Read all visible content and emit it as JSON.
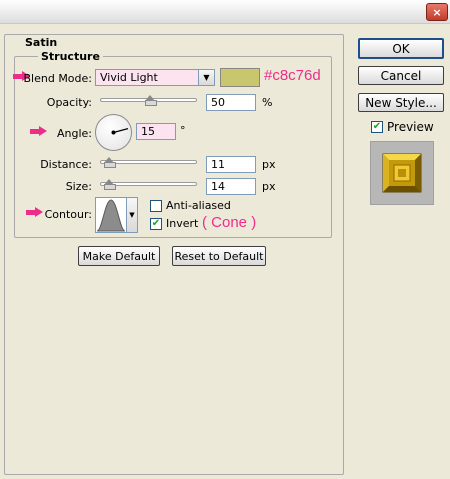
{
  "window": {
    "close_label": "×"
  },
  "panel": {
    "title": "Satin",
    "group_title": "Structure"
  },
  "blend_mode": {
    "label": "Blend Mode:",
    "value": "Vivid Light",
    "color": "#c8c76d",
    "color_hex_annotation": "#c8c76d"
  },
  "opacity": {
    "label": "Opacity:",
    "value": "50",
    "unit": "%",
    "fraction": 0.5
  },
  "angle": {
    "label": "Angle:",
    "value": "15",
    "unit": "°"
  },
  "distance": {
    "label": "Distance:",
    "value": "11",
    "unit": "px",
    "fraction": 0.05
  },
  "size": {
    "label": "Size:",
    "value": "14",
    "unit": "px",
    "fraction": 0.05
  },
  "contour": {
    "label": "Contour:",
    "anti_aliased_label": "Anti-aliased",
    "anti_aliased_checked": false,
    "invert_label": "Invert",
    "invert_checked": true,
    "note": "( Cone )"
  },
  "buttons": {
    "make_default": "Make Default",
    "reset_default": "Reset to Default",
    "ok": "OK",
    "cancel": "Cancel",
    "new_style": "New Style..."
  },
  "preview": {
    "label": "Preview",
    "checked": true
  },
  "accent_color": "#ee2d89",
  "icons": {
    "arrow": "pink-arrow-icon",
    "close": "close-icon",
    "dropdown": "chevron-down-icon"
  }
}
